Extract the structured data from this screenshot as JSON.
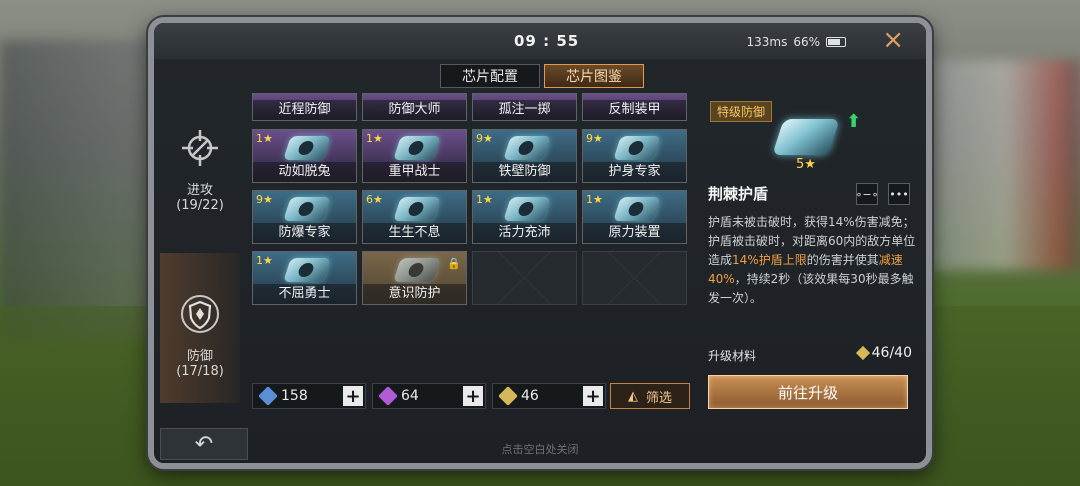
{
  "topbar": {
    "time": "09 : 55",
    "ping": "133ms",
    "battery": "66%",
    "close_icon": "×"
  },
  "tabs": [
    {
      "label": "芯片配置",
      "active": false
    },
    {
      "label": "芯片图鉴",
      "active": true
    }
  ],
  "categories": {
    "attack": {
      "label": "进攻",
      "count": "(19/22)"
    },
    "defense": {
      "label": "防御",
      "count": "(17/18)"
    }
  },
  "chips_row0": [
    "近程防御",
    "防御大师",
    "孤注一掷",
    "反制装甲"
  ],
  "chips": [
    {
      "name": "动如脱兔",
      "level": "1★",
      "color": "p"
    },
    {
      "name": "重甲战士",
      "level": "1★",
      "color": "p"
    },
    {
      "name": "铁壁防御",
      "level": "9★",
      "color": "b"
    },
    {
      "name": "护身专家",
      "level": "9★",
      "color": "b"
    },
    {
      "name": "防爆专家",
      "level": "9★",
      "color": "b"
    },
    {
      "name": "生生不息",
      "level": "6★",
      "color": "b"
    },
    {
      "name": "活力充沛",
      "level": "1★",
      "color": "b"
    },
    {
      "name": "原力装置",
      "level": "1★",
      "color": "b"
    },
    {
      "name": "不屈勇士",
      "level": "1★",
      "color": "b"
    },
    {
      "name": "意识防护",
      "level": "",
      "color": "g",
      "locked": true
    }
  ],
  "resources": [
    {
      "value": "158",
      "color": "#5a8fd6"
    },
    {
      "value": "64",
      "color": "#b05ad6"
    },
    {
      "value": "46",
      "color": "#d6b85a"
    }
  ],
  "filter_label": "筛选",
  "detail": {
    "rank": "特级防御",
    "stars": "5★",
    "title": "荆棘护盾",
    "desc_parts": [
      "护盾未被击破时，获得14%伤害减免；护盾被击破时，对距离60内的敌方单位造成",
      "14%护盾上限",
      "的伤害并使其",
      "减速40%",
      "，持续2秒（该效果每30秒最多触发一次）。"
    ],
    "material_label": "升级材料",
    "material_value": "46/40",
    "upgrade_label": "前往升级",
    "share_icon": "∘−∘",
    "more_icon": "•••"
  },
  "back_icon": "↶",
  "bottom_hint": "点击空白处关闭"
}
